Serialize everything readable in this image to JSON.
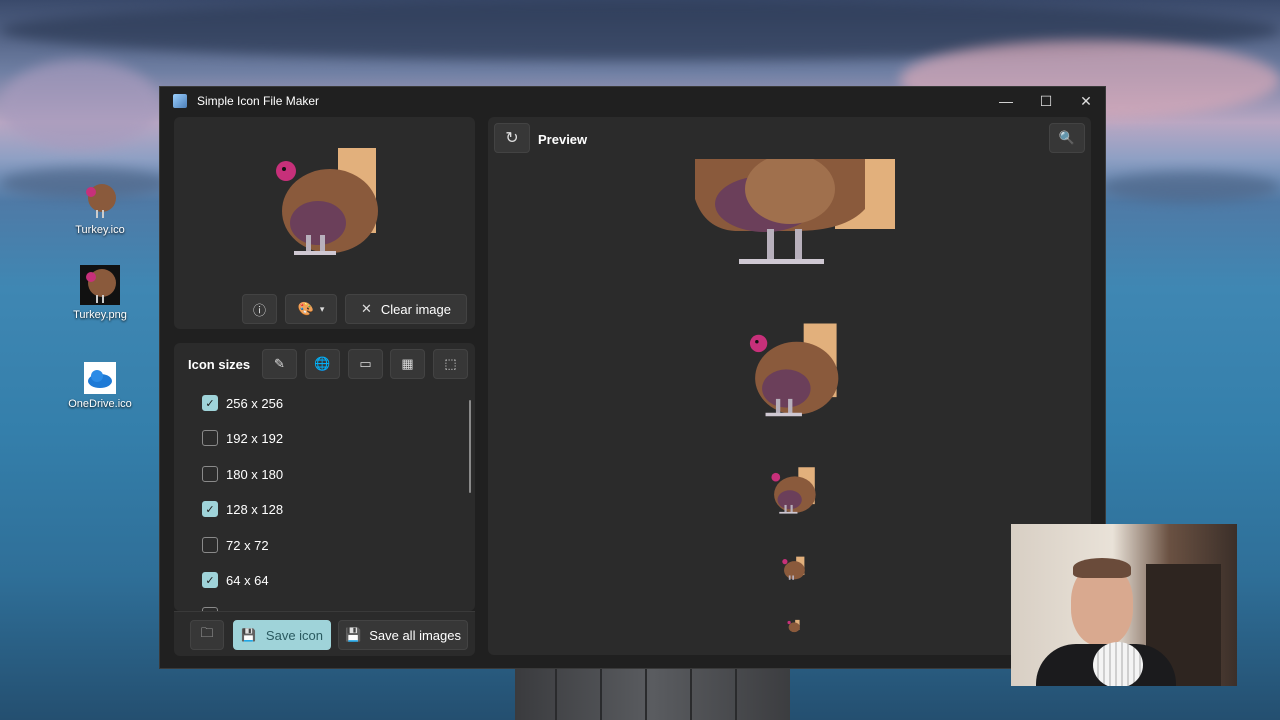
{
  "window": {
    "title": "Simple Icon File Maker",
    "controls": {
      "minimize": "—",
      "maximize": "☐",
      "close": "✕"
    }
  },
  "desktop_icons": [
    {
      "label": "Turkey.ico",
      "icon": "turkey-icon"
    },
    {
      "label": "Turkey.png",
      "icon": "turkey-icon"
    },
    {
      "label": "OneDrive.ico",
      "icon": "cloud-icon"
    }
  ],
  "source_panel": {
    "info_icon": "info-icon",
    "palette_icon": "palette-icon",
    "clear_label": "Clear image"
  },
  "sizes_panel": {
    "heading": "Icon sizes",
    "toolbar_icons": [
      "pencil-icon",
      "globe-icon",
      "laptop-icon",
      "qr-icon",
      "selection-icon"
    ],
    "sizes": [
      {
        "label": "256 x 256",
        "checked": true
      },
      {
        "label": "192 x 192",
        "checked": false
      },
      {
        "label": "180 x 180",
        "checked": false
      },
      {
        "label": "128 x 128",
        "checked": true
      },
      {
        "label": "72 x 72",
        "checked": false
      },
      {
        "label": "64 x 64",
        "checked": true
      }
    ]
  },
  "bottom_bar": {
    "open_folder_icon": "folder-icon",
    "save_icon_label": "Save icon",
    "save_all_label": "Save all images"
  },
  "preview": {
    "title": "Preview",
    "refresh_icon": "refresh-icon",
    "zoom_icon": "zoom-in-icon"
  },
  "colors": {
    "accent": "#9fd3d9",
    "window_bg": "#202020",
    "panel_bg": "#2b2b2b"
  }
}
